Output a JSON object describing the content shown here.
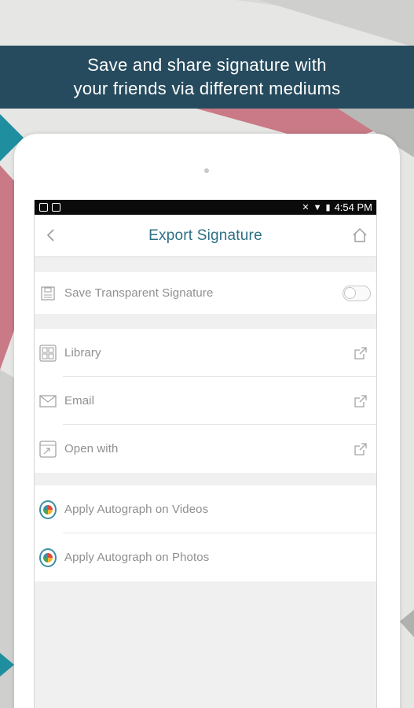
{
  "banner": {
    "line1": "Save and share signature with",
    "line2": "your friends via different mediums"
  },
  "status_bar": {
    "time": "4:54 PM",
    "left_icons": [
      "image-icon",
      "message-icon"
    ],
    "right_icons": [
      "mute-icon",
      "wifi-icon",
      "battery-icon"
    ]
  },
  "header": {
    "title": "Export Signature",
    "back_icon": "chevron-left-icon",
    "home_icon": "home-icon"
  },
  "settings": {
    "save_transparent_label": "Save Transparent Signature",
    "save_transparent_enabled": false
  },
  "share_items": [
    {
      "label": "Library",
      "icon": "grid-icon",
      "action_icon": "external-link-icon"
    },
    {
      "label": "Email",
      "icon": "envelope-icon",
      "action_icon": "external-link-icon"
    },
    {
      "label": "Open with",
      "icon": "open-with-icon",
      "action_icon": "external-link-icon"
    }
  ],
  "apply_items": [
    {
      "label": "Apply Autograph on Videos",
      "icon": "video-autograph-icon"
    },
    {
      "label": "Apply Autograph on Photos",
      "icon": "photo-autograph-icon"
    }
  ],
  "colors": {
    "banner_bg": "#274b5e",
    "title": "#2c6f84",
    "label": "#8f8f8f",
    "accent_pink": "#c97a86",
    "accent_teal": "#1f8fa0"
  }
}
